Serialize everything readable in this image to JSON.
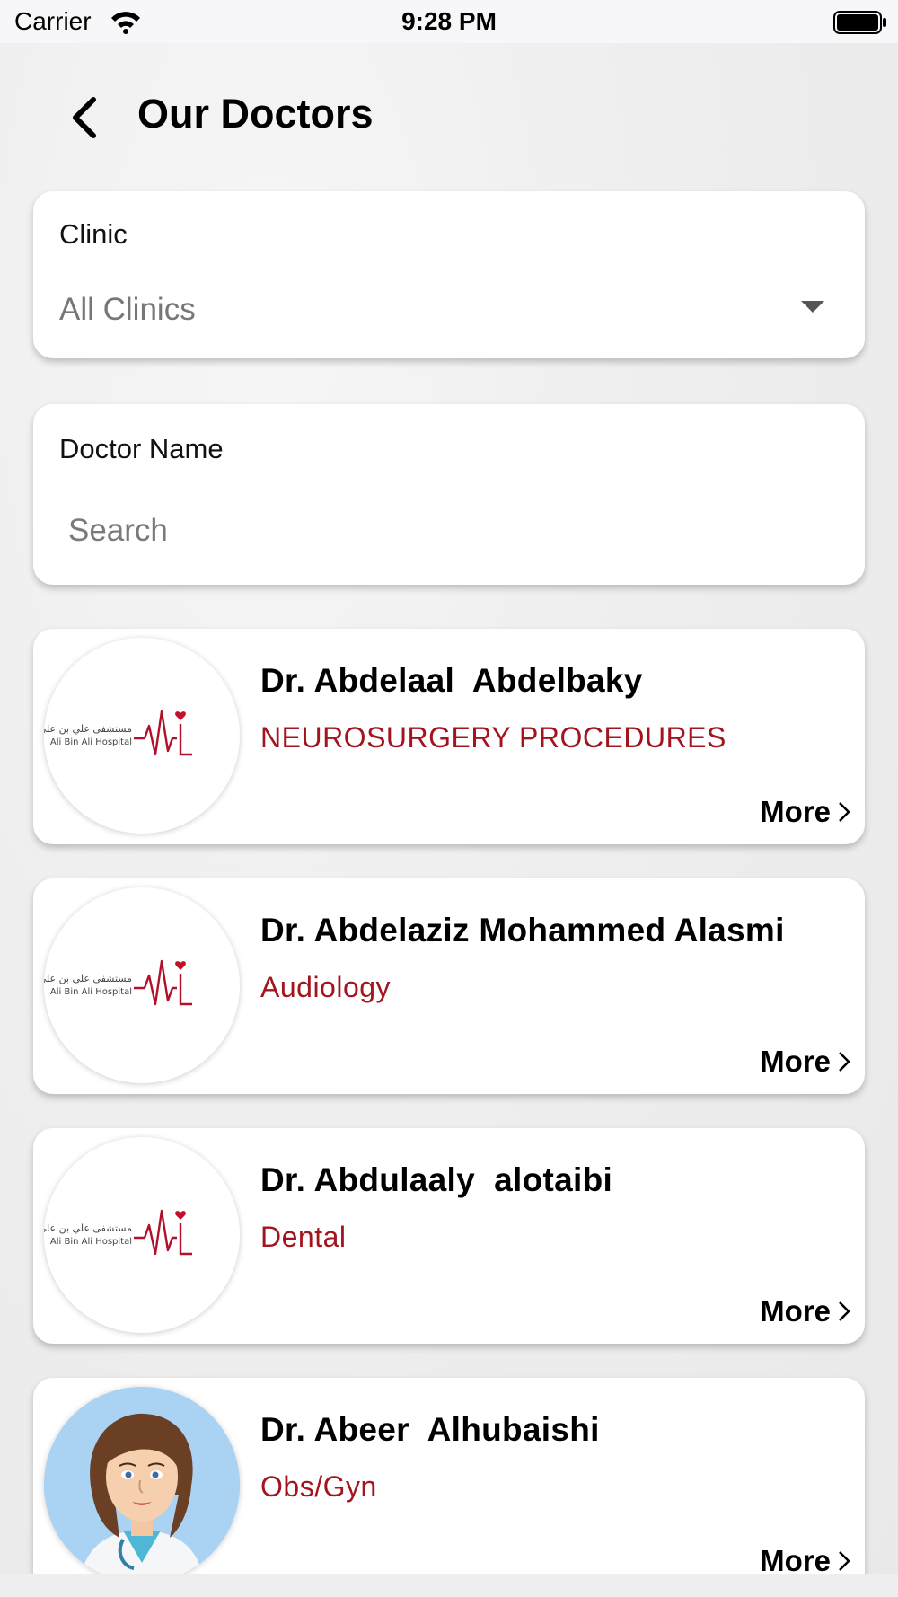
{
  "status_bar": {
    "carrier": "Carrier",
    "time": "9:28 PM"
  },
  "header": {
    "title": "Our Doctors"
  },
  "filters": {
    "clinic_label": "Clinic",
    "clinic_value": "All Clinics",
    "doctor_name_label": "Doctor Name",
    "search_placeholder": "Search"
  },
  "doctors": [
    {
      "name": "Dr. Abdelaal  Abdelbaky",
      "specialty": "NEUROSURGERY PROCEDURES",
      "more_label": "More",
      "avatar": "hospital-logo"
    },
    {
      "name": "Dr. Abdelaziz Mohammed Alasmi",
      "specialty": "Audiology",
      "more_label": "More",
      "avatar": "hospital-logo"
    },
    {
      "name": "Dr. Abdulaaly  alotaibi",
      "specialty": "Dental",
      "more_label": "More",
      "avatar": "hospital-logo"
    },
    {
      "name": "Dr. Abeer  Alhubaishi",
      "specialty": "Obs/Gyn",
      "more_label": "More",
      "avatar": "female-doctor-illustration"
    }
  ],
  "logo": {
    "arabic_text": "مستشفى علي بن علي",
    "english_text": "Ali Bin Ali Hospital"
  },
  "colors": {
    "accent": "#a3141e",
    "card": "#ffffff",
    "background": "#eeeeee"
  }
}
